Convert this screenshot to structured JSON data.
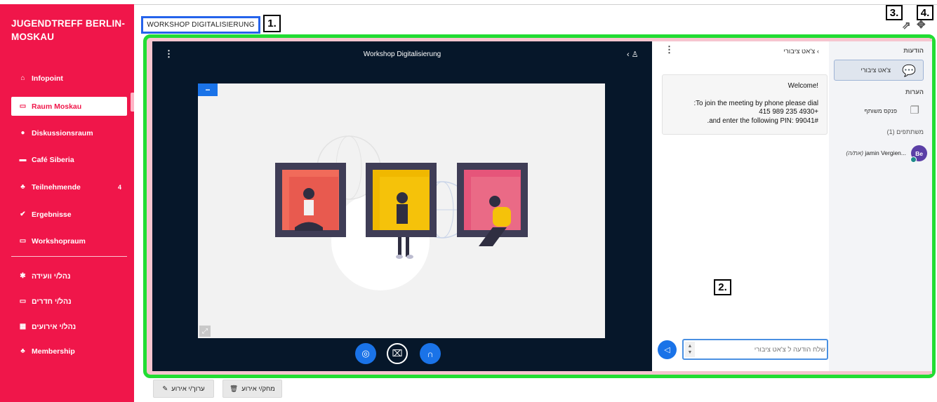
{
  "sidebar": {
    "brand": "JUGENDTREFF BERLIN-MOSKAU",
    "items": [
      {
        "label": "Infopoint",
        "icon": "home-icon"
      },
      {
        "label": "Raum Moskau",
        "icon": "room-icon"
      },
      {
        "label": "Diskussionsraum",
        "icon": "chat-icon"
      },
      {
        "label": "Café Siberia",
        "icon": "coffee-icon"
      },
      {
        "label": "Teilnehmende",
        "icon": "users-icon",
        "count": "4"
      },
      {
        "label": "Ergebnisse",
        "icon": "check-icon"
      },
      {
        "label": "Workshopraum",
        "icon": "room-icon"
      }
    ],
    "admin": [
      {
        "label": "נהל/י וועידה",
        "icon": "gear-icon"
      },
      {
        "label": "נהל/י חדרים",
        "icon": "room-icon"
      },
      {
        "label": "נהל/י אירועים",
        "icon": "calendar-icon"
      },
      {
        "label": "Membership",
        "icon": "membership-icon"
      }
    ]
  },
  "header": {
    "title": "WORKSHOP DIGITALISIERUNG",
    "markers": [
      "1.",
      "2.",
      "3.",
      "4."
    ]
  },
  "video": {
    "title": "Workshop Digitalisierung"
  },
  "chat": {
    "title": "צ'אט ציבורי",
    "welcome": "Welcome!",
    "lines": [
      ":To join the meeting by phone please dial",
      "415 989 235 4930+",
      ".and enter the following PIN: 99041#"
    ],
    "input_placeholder": "שלח הודעה ל צ'אט ציבורי"
  },
  "users": {
    "messages_header": "הודעות",
    "public_chat": "צ'אט ציבורי",
    "notes_header": "הערות",
    "shared_notes": "פנקס משותף",
    "participants_header": "משתתפים (1)",
    "participant": {
      "initials": "Be",
      "name": "jamin Vergien...",
      "role": "(את/ה)"
    }
  },
  "buttons": {
    "edit": "ערוך/י אירוע",
    "delete": "מחק/י אירוע"
  },
  "colors": {
    "sidebar": "#f0164a",
    "frame": "#22dd33",
    "accent": "#1a73e8"
  }
}
